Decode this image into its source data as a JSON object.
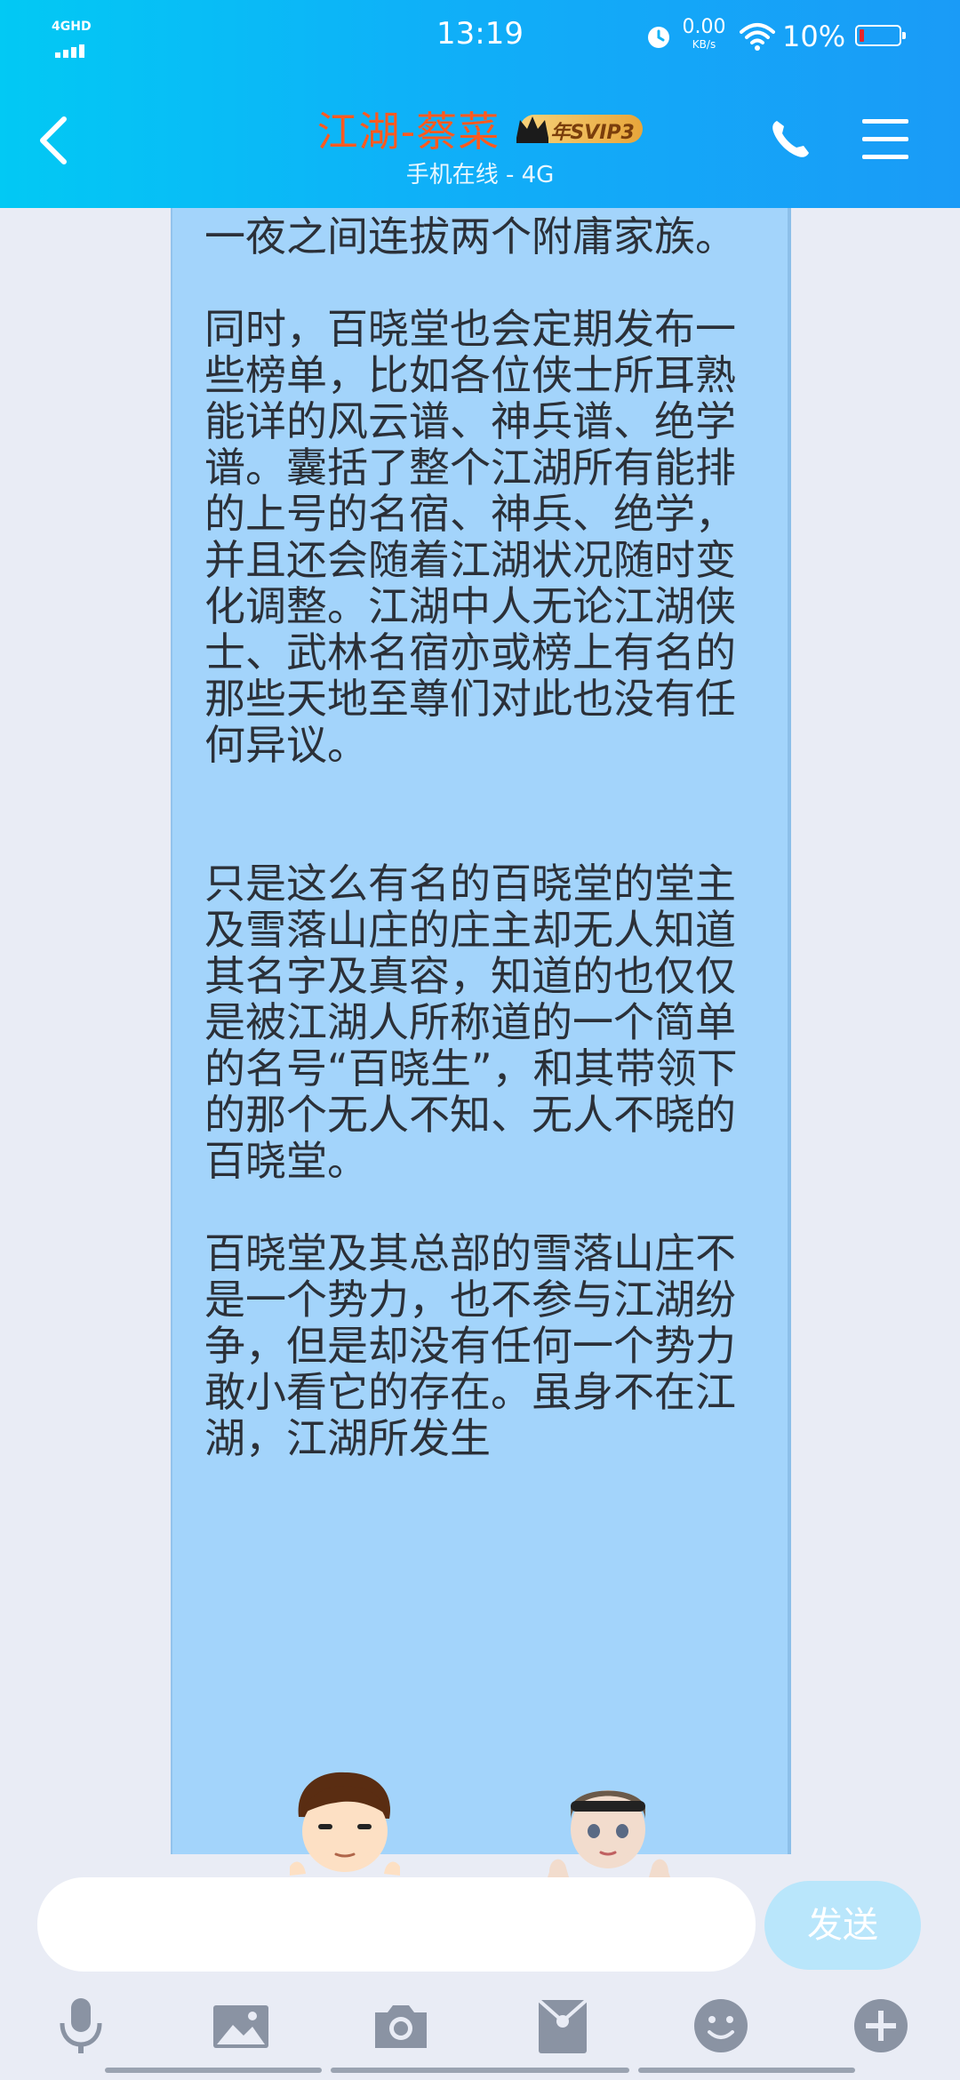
{
  "status_bar": {
    "network": "4GHD",
    "time": "13:19",
    "speed_value": "0.00",
    "speed_unit": "KB/s",
    "battery": "10%"
  },
  "header": {
    "title": "江湖-蔡菜",
    "badge": "年SVIP3",
    "subtitle": "手机在线 - 4G"
  },
  "message": {
    "paragraphs": [
      "晓堂的秘密据点想要得到藏剑们的情报却不想付钱被百晓堂一夜之间连拔两个附庸家族。",
      "同时，百晓堂也会定期发布一些榜单，比如各位侠士所耳熟能详的风云谱、神兵谱、绝学谱。囊括了整个江湖所有能排的上号的名宿、神兵、绝学，并且还会随着江湖状况随时变化调整。江湖中人无论江湖侠士、武林名宿亦或榜上有名的那些天地至尊们对此也没有任何异议。",
      "只是这么有名的百晓堂的堂主及雪落山庄的庄主却无人知道其名字及真容，知道的也仅仅是被江湖人所称道的一个简单的名号“百晓生”，和其带领下的那个无人不知、无人不晓的百晓堂。",
      "百晓堂及其总部的雪落山庄不是一个势力，也不参与江湖纷争，但是却没有任何一个势力敢小看它的存在。虽身不在江湖，江湖所发生"
    ]
  },
  "input": {
    "placeholder": "",
    "send_label": "发送"
  },
  "toolbar": {
    "icons": [
      "microphone-icon",
      "image-icon",
      "camera-icon",
      "red-packet-icon",
      "emoji-icon",
      "plus-icon"
    ]
  },
  "colors": {
    "header_start": "#02c9f4",
    "header_end": "#1a9bf7",
    "title": "#ff5a1f",
    "bubble": "#a3d4fb",
    "background": "#e9ecf5",
    "send_button": "#b9e6fb",
    "toolbar_icon": "#8a93a3"
  }
}
